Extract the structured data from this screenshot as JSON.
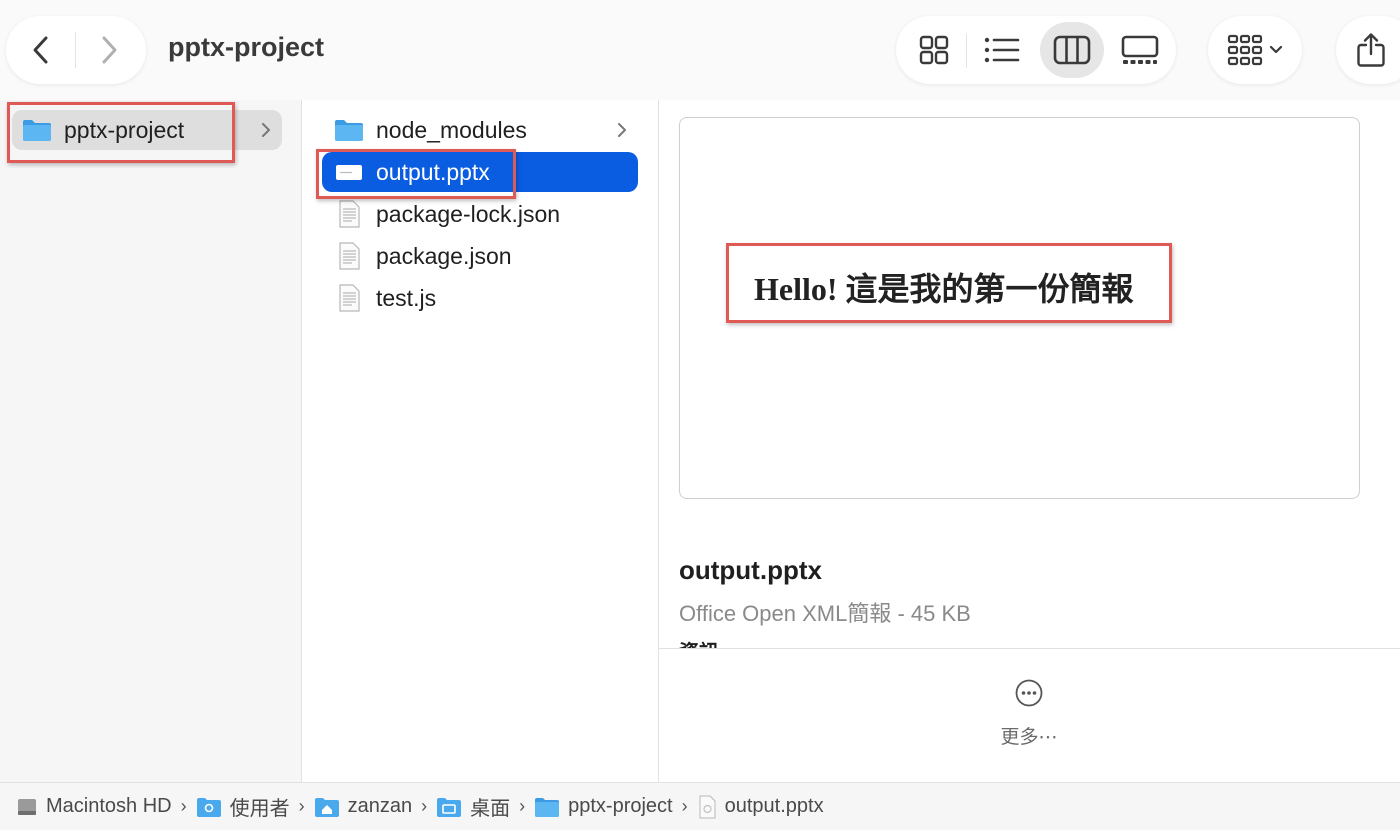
{
  "window": {
    "title": "pptx-project"
  },
  "sidebar_column": {
    "items": [
      {
        "label": "pptx-project",
        "icon": "folder-icon",
        "selected": true
      }
    ]
  },
  "files_column": {
    "items": [
      {
        "label": "node_modules",
        "icon": "folder-icon",
        "has_children": true
      },
      {
        "label": "output.pptx",
        "icon": "pptx-file-icon",
        "selected": true
      },
      {
        "label": "package-lock.json",
        "icon": "document-icon"
      },
      {
        "label": "package.json",
        "icon": "document-icon"
      },
      {
        "label": "test.js",
        "icon": "document-icon"
      }
    ]
  },
  "preview": {
    "slide_text": "Hello! 這是我的第一份簡報",
    "file_name": "output.pptx",
    "file_kind": "Office Open XML簡報 - 45 KB",
    "info_heading": "資訊",
    "more_label": "更多⋯"
  },
  "path_bar": [
    {
      "label": "Macintosh HD",
      "icon": "hard-drive-icon"
    },
    {
      "label": "使用者",
      "icon": "users-folder-icon"
    },
    {
      "label": "zanzan",
      "icon": "home-folder-icon"
    },
    {
      "label": "桌面",
      "icon": "desktop-folder-icon"
    },
    {
      "label": "pptx-project",
      "icon": "folder-icon"
    },
    {
      "label": "output.pptx",
      "icon": "pptx-file-icon"
    }
  ],
  "colors": {
    "selection": "#0a5ce0",
    "folder": "#4aa8ec",
    "highlight_box": "#e05a55"
  }
}
